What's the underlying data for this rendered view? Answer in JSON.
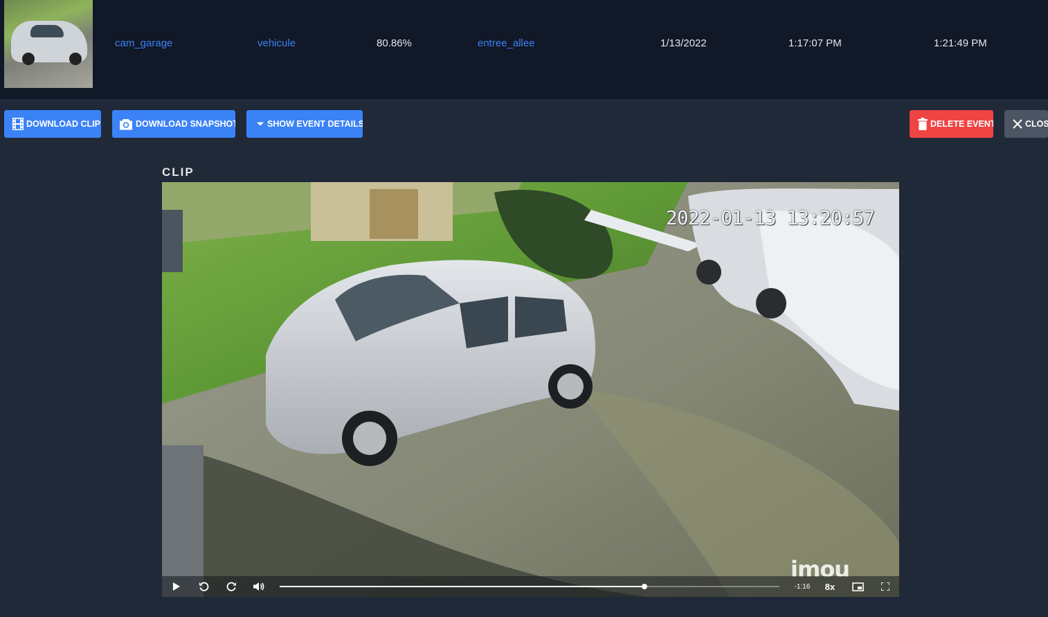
{
  "event": {
    "camera": "cam_garage",
    "label": "vehicule",
    "score": "80.86%",
    "zone": "entree_allee",
    "date": "1/13/2022",
    "start_time": "1:17:07 PM",
    "end_time": "1:21:49 PM"
  },
  "actions": {
    "download_clip": "DOWNLOAD CLIP",
    "download_snapshot": "DOWNLOAD SNAPSHOT",
    "show_event_details": "SHOW EVENT DETAILS",
    "delete_event": "DELETE EVENT",
    "close": "CLOSE"
  },
  "clip": {
    "heading": "CLIP",
    "overlay_timestamp": "2022-01-13 13:20:57",
    "watermark": "imou",
    "player": {
      "time_remaining": "-1:16",
      "playback_speed": "8x",
      "progress_fraction": 0.73
    }
  },
  "colors": {
    "primary": "#3b82f6",
    "danger": "#ef4444",
    "neutral": "#4b5563",
    "page_bg": "#1f2937",
    "row_bg": "#111827"
  }
}
